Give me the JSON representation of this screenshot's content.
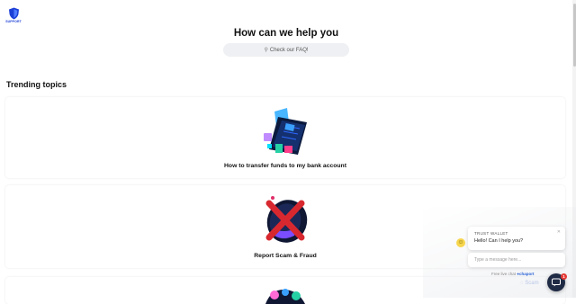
{
  "header": {
    "logo_text": "SUPPORT",
    "title": "How can we help you",
    "search_placeholder": "Check our FAQ!",
    "search_icon": "search-icon"
  },
  "trending": {
    "title": "Trending topics",
    "cards": [
      {
        "title": "How to transfer funds to my bank account",
        "icon": "card-transfer-illustration"
      },
      {
        "title": "Report Scam & Fraud",
        "icon": "scam-report-illustration"
      },
      {
        "title": "",
        "icon": "partial-illustration"
      }
    ]
  },
  "chat": {
    "agent_name": "TRUST WALLET",
    "greeting": "Hello! Can I help you?",
    "input_placeholder": "Type a message here...",
    "powered_prefix": "Free live chat",
    "powered_brand": "chaport",
    "scam_tag": "Scam",
    "unread_count": "1"
  },
  "colors": {
    "brand_blue": "#1c3fd6",
    "launcher": "#1f2a44",
    "badge": "#e53935",
    "search_bg": "#eef0f3"
  }
}
